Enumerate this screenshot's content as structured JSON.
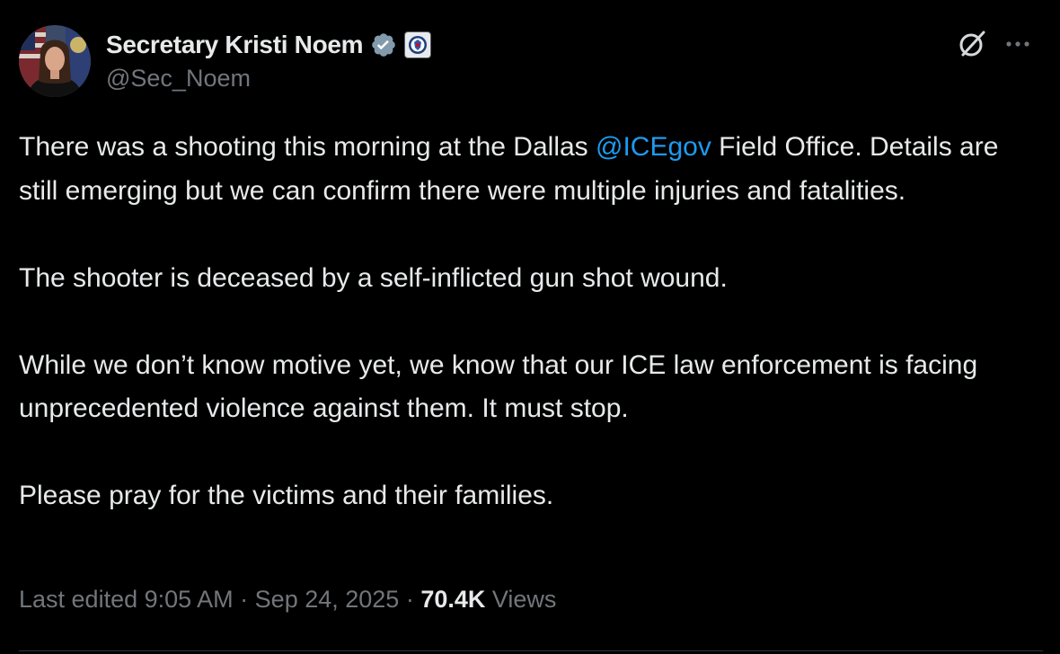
{
  "author": {
    "display_name": "Secretary Kristi Noem",
    "handle": "@Sec_Noem",
    "verified_badge": "verified-gray-check-icon",
    "affiliate_badge": "dhs-seal-icon"
  },
  "actions": {
    "grok_icon": "grok-icon",
    "more_icon": "more-options-icon"
  },
  "post": {
    "p1_before": "There was a shooting this morning at the Dallas ",
    "p1_mention": "@ICEgov",
    "p1_after": " Field Office. Details are still emerging but we can confirm there were multiple injuries and fatalities.",
    "p2": "The shooter is deceased by a self-inflicted gun shot wound.",
    "p3": "While we don’t know motive yet, we know that our ICE law enforcement is facing unprecedented violence against them. It must stop.",
    "p4": "Please pray for the victims and their families."
  },
  "meta": {
    "edited_label": "Last edited 9:05 AM",
    "sep1": " · ",
    "date": "Sep 24, 2025",
    "sep2": " · ",
    "views_count": "70.4K",
    "views_label": " Views"
  },
  "colors": {
    "background": "#000000",
    "text": "#e7e9ea",
    "secondary": "#71767b",
    "link": "#1d9bf0"
  }
}
